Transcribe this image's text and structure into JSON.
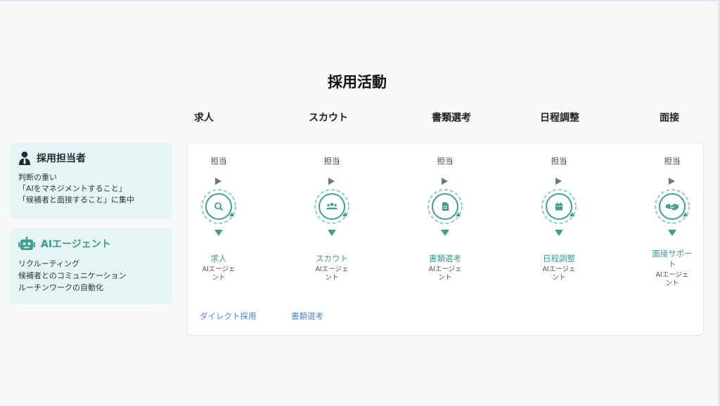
{
  "title": "採用活動",
  "phases": [
    "求人",
    "スカウト",
    "書類選考",
    "日程調整",
    "面接"
  ],
  "human_card": {
    "title": "採用担当者",
    "lines": [
      "判断の重い",
      "「AIをマネジメントすること」",
      "「候補者と面接すること」に集中"
    ]
  },
  "ai_card": {
    "title": "AIエージェント",
    "lines": [
      "リクルーティング",
      "候補者とのコミュニケーション",
      "ルーチンワークの自動化"
    ]
  },
  "stages": [
    {
      "owner": "担当",
      "name": "求人",
      "sub": "AIエージェ\nント",
      "icon": "search-icon"
    },
    {
      "owner": "担当",
      "name": "スカウト",
      "sub": "AIエージェ\nント",
      "icon": "people-icon"
    },
    {
      "owner": "担当",
      "name": "書類選考",
      "sub": "AIエージェ\nント",
      "icon": "document-icon"
    },
    {
      "owner": "担当",
      "name": "日程調整",
      "sub": "AIエージェ\nント",
      "icon": "calendar-icon"
    },
    {
      "owner": "担当",
      "name": "面接サポー\nト",
      "sub": "AIエージェ\nント",
      "icon": "handshake-icon"
    }
  ],
  "links": [
    "ダイレクト採用",
    "書類選考"
  ],
  "colors": {
    "accent": "#3f9f91",
    "link": "#4a86cf",
    "card_bg": "#e6f4f3"
  }
}
